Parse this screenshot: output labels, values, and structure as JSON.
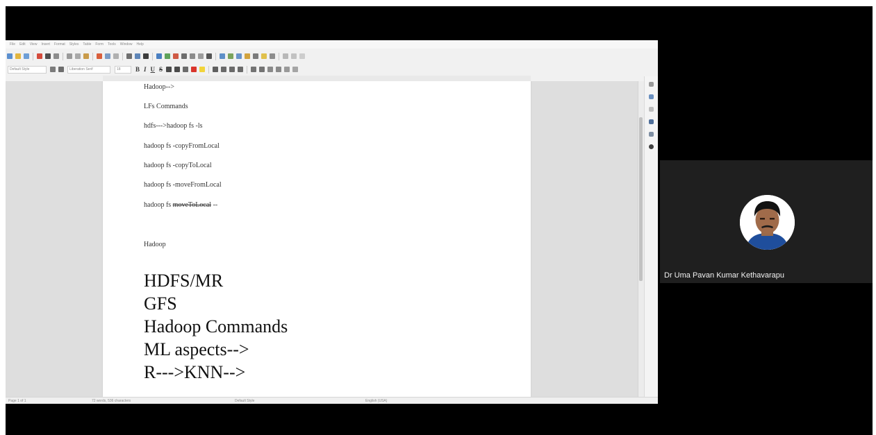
{
  "menubar": {
    "items": [
      "File",
      "Edit",
      "View",
      "Insert",
      "Format",
      "Styles",
      "Table",
      "Form",
      "Tools",
      "Window",
      "Help"
    ]
  },
  "formatting_bar": {
    "paragraph_style": "Default Style",
    "font_name": "Liberation Serif",
    "font_size": "18",
    "bold_label": "B",
    "italic_label": "I",
    "underline_label": "U",
    "strikethrough_label": "S"
  },
  "document": {
    "lines": {
      "l1": "Hadoop-->",
      "l2": "LFs Commands",
      "l3": "hdfs--->hadoop fs -ls",
      "l4": "hadoop fs -copyFromLocal",
      "l5": "hadoop fs -copyToLocal",
      "l6": "hadoop fs -moveFromLocal",
      "l7_prefix": "hadoop fs ",
      "l7_struck": "moveToLocal",
      "l7_suffix": " --",
      "l8": "Hadoop",
      "b1": "HDFS/MR",
      "b2": "GFS",
      "b3": "Hadoop Commands",
      "b4": "ML aspects-->",
      "b5": "R--->KNN-->"
    }
  },
  "statusbar": {
    "page": "Page 1 of 1",
    "words": "72 words, 536 characters",
    "style": "Default Style",
    "language": "English (USA)"
  },
  "participant": {
    "name": "Dr Uma Pavan Kumar Kethavarapu"
  }
}
